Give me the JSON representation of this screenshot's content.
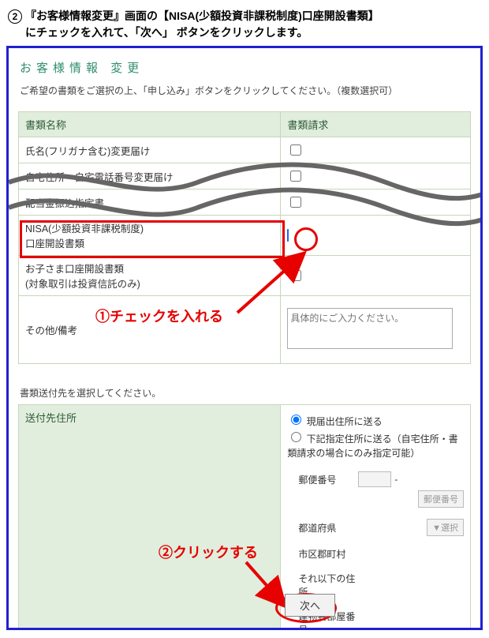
{
  "step": {
    "number": "2",
    "text_line1": "『お客様情報変更』画面の【NISA(少額投資非課税制度)口座開設書類】",
    "text_line2": "にチェックを入れて、「次へ」 ボタンをクリックします。"
  },
  "page_title": {
    "a": "お客様情報",
    "b": "変更"
  },
  "instruction1": "ご希望の書類をご選択の上、「申し込み」ボタンをクリックしてください。（複数選択可）",
  "doc_table": {
    "head_name": "書類名称",
    "head_req": "書類請求",
    "rows": [
      {
        "name": "氏名(フリガナ含む)変更届け",
        "checked": false
      },
      {
        "name": "自宅住所・自宅電話番号変更届け",
        "checked": false
      },
      {
        "name": "配当金振込指定書",
        "checked": false
      },
      {
        "name_l1": "NISA(少額投資非課税制度)",
        "name_l2": "口座開設書類",
        "checked": true
      },
      {
        "name_l1": "お子さま口座開設書類",
        "name_l2": "(対象取引は投資信託のみ)",
        "checked": false
      }
    ],
    "other_label": "その他/備考",
    "textarea_placeholder": "具体的にご入力ください。"
  },
  "instruction2": "書類送付先を選択してください。",
  "addr": {
    "head": "送付先住所",
    "radio1": "現届出住所に送る",
    "radio2": "下記指定住所に送る（自宅住所・書類請求の場合にのみ指定可能）",
    "postal": "郵便番号",
    "postal_btn": "郵便番号",
    "pref": "都道府県",
    "pref_sel": "▼選択",
    "city": "市区郡町村",
    "rest": "それ以下の住所",
    "bldg": "建物名部屋番号"
  },
  "next_btn": "次へ",
  "anno": {
    "check": "①チェックを入れる",
    "click": "②クリックする"
  }
}
